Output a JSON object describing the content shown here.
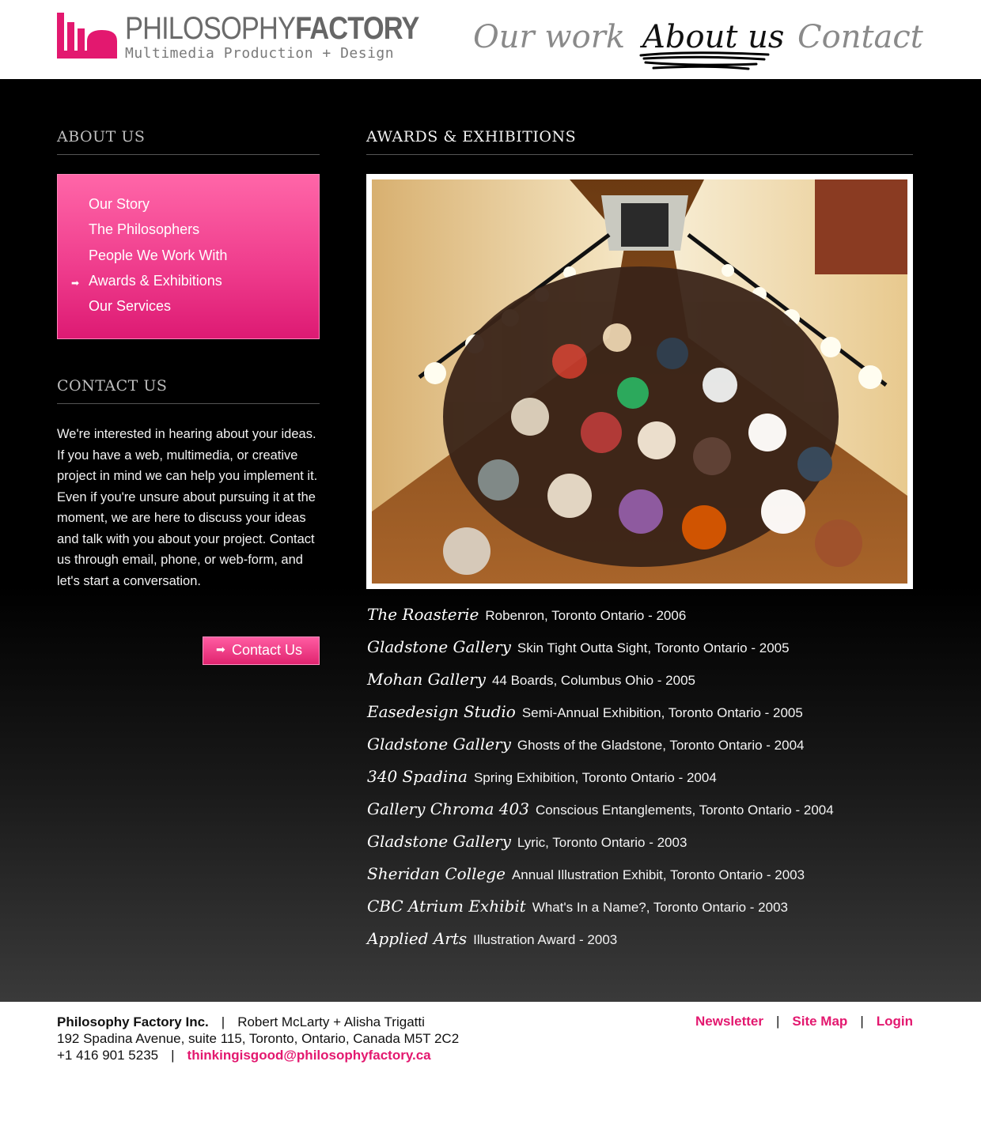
{
  "header": {
    "logo_title_light": "PHILOSOPHY",
    "logo_title_bold": "FACTORY",
    "logo_subtitle": "Multimedia Production + Design",
    "brand_color": "#e3186f",
    "nav": {
      "our_work": "Our work",
      "about_us": "About us",
      "contact": "Contact"
    },
    "active_nav": "about_us"
  },
  "sidebar": {
    "about_heading": "ABOUT US",
    "menu": [
      {
        "label": "Our Story",
        "active": false
      },
      {
        "label": "The Philosophers",
        "active": false
      },
      {
        "label": "People We Work With",
        "active": false
      },
      {
        "label": "Awards & Exhibitions",
        "active": true
      },
      {
        "label": "Our Services",
        "active": false
      }
    ],
    "contact_heading": "CONTACT US",
    "contact_text": "We're interested in hearing about your ideas. If you have a web, multimedia, or creative project in mind we can help you implement it. Even if you're unsure about pursuing it at the moment, we are here to discuss your ideas and talk with you about your project. Contact us through email, phone, or web-form, and let's start a conversation.",
    "contact_button": "Contact Us"
  },
  "content": {
    "heading": "AWARDS & EXHIBITIONS",
    "exhibitions": [
      {
        "venue": "The Roasterie",
        "detail": "Robenron, Toronto Ontario - 2006"
      },
      {
        "venue": "Gladstone Gallery",
        "detail": "Skin Tight Outta Sight, Toronto Ontario - 2005"
      },
      {
        "venue": "Mohan Gallery",
        "detail": "44 Boards, Columbus Ohio - 2005"
      },
      {
        "venue": "Easedesign Studio",
        "detail": "Semi-Annual Exhibition, Toronto Ontario - 2005"
      },
      {
        "venue": "Gladstone Gallery",
        "detail": "Ghosts of the Gladstone, Toronto Ontario - 2004"
      },
      {
        "venue": "340 Spadina",
        "detail": "Spring Exhibition, Toronto Ontario - 2004"
      },
      {
        "venue": "Gallery Chroma 403",
        "detail": "Conscious Entanglements, Toronto Ontario - 2004"
      },
      {
        "venue": "Gladstone Gallery",
        "detail": "Lyric, Toronto Ontario - 2003"
      },
      {
        "venue": "Sheridan College",
        "detail": "Annual Illustration Exhibit, Toronto Ontario - 2003"
      },
      {
        "venue": "CBC Atrium Exhibit",
        "detail": "What's In a Name?, Toronto Ontario - 2003"
      },
      {
        "venue": "Applied Arts",
        "detail": "Illustration Award - 2003"
      }
    ]
  },
  "footer": {
    "company": "Philosophy Factory Inc.",
    "people": "Robert McLarty + Alisha Trigatti",
    "address": "192 Spadina Avenue, suite 115, Toronto, Ontario, Canada M5T 2C2",
    "phone": "+1 416 901 5235",
    "email": "thinkingisgood@philosophyfactory.ca",
    "separator": "|",
    "links": {
      "newsletter": "Newsletter",
      "site_map": "Site Map",
      "login": "Login"
    }
  }
}
